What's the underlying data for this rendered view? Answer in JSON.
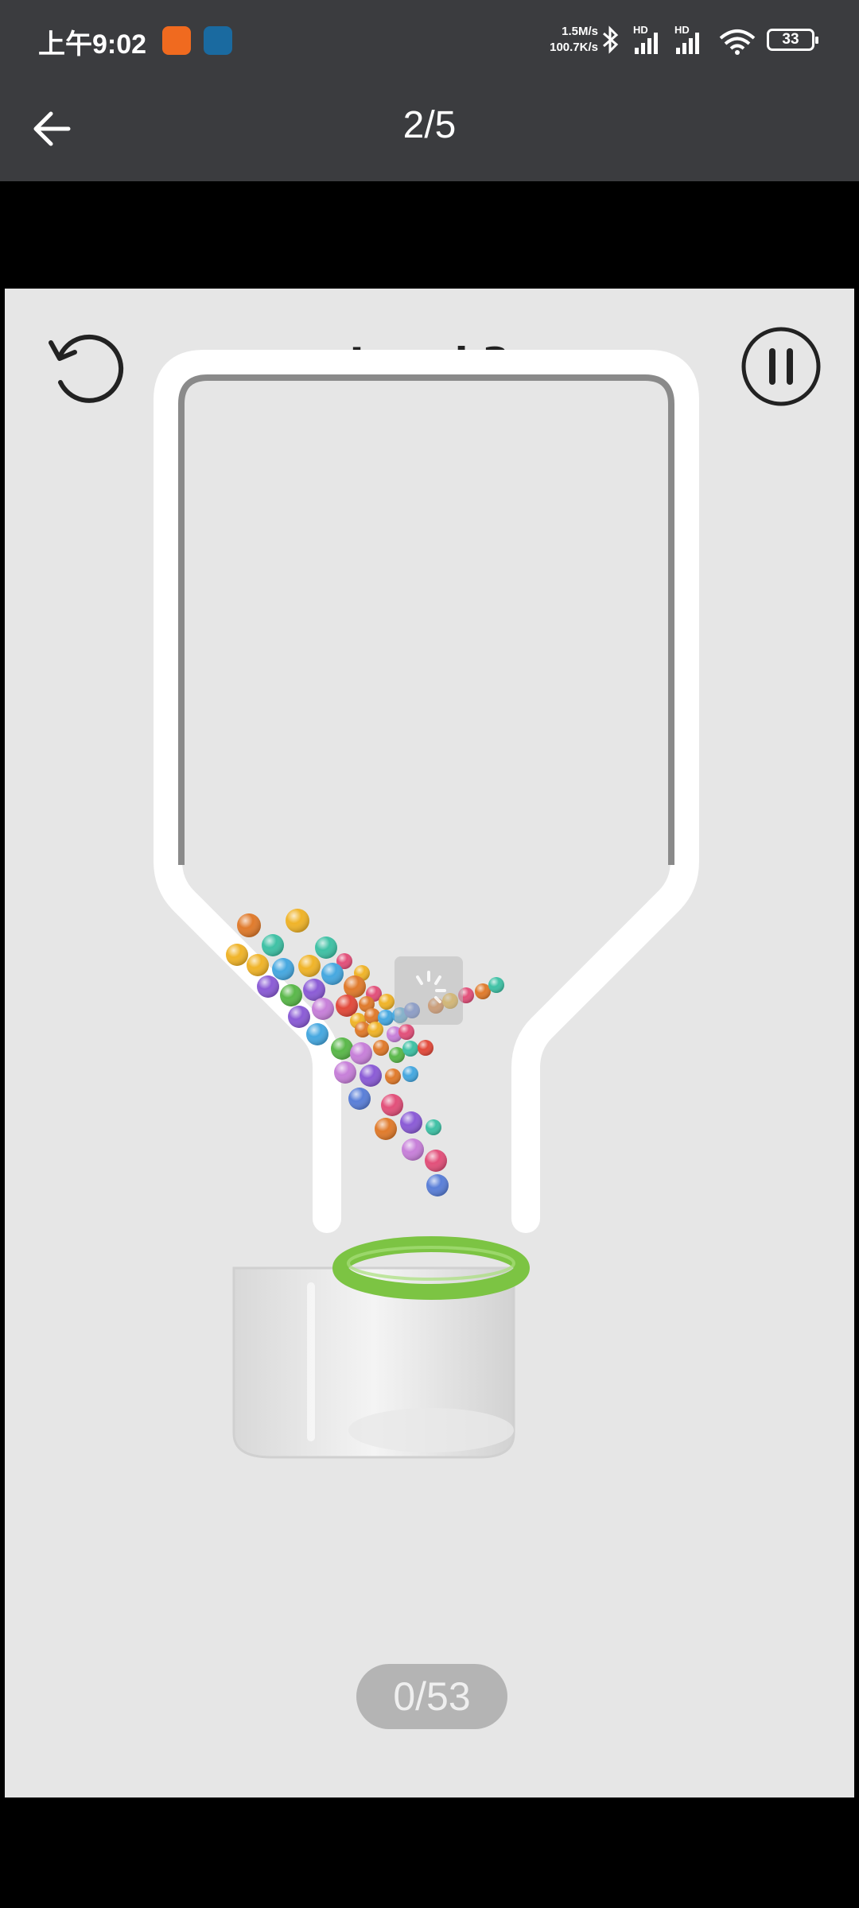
{
  "status_bar": {
    "time": "上午9:02",
    "net_speed_down": "1.5M/s",
    "net_speed_up": "100.7K/s",
    "signal_1_label": "HD",
    "signal_2_label": "HD",
    "battery_level": "33",
    "icons": [
      "notification-app-icon",
      "notification-app-icon",
      "bluetooth-icon",
      "signal-icon",
      "signal-icon",
      "wifi-icon",
      "battery-icon"
    ]
  },
  "title_bar": {
    "page_counter": "2/5"
  },
  "game": {
    "level_label": "Level 3",
    "progress_text": "0/53",
    "cup_rim_color": "#7cc443",
    "background_color": "#e6e6e6"
  }
}
